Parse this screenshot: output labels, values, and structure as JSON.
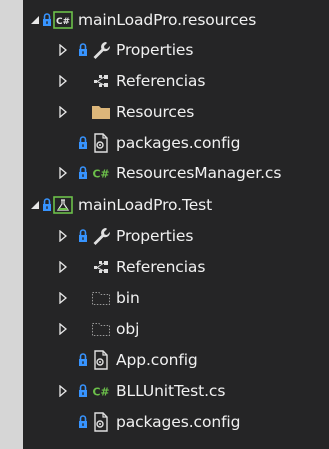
{
  "tree": {
    "items": [
      {
        "label": "mainLoadPro.resources",
        "icon": "csharp-project-icon",
        "expander": "expanded",
        "lock": true
      },
      {
        "label": "Properties",
        "icon": "wrench-icon",
        "expander": "collapsed",
        "lock": true
      },
      {
        "label": "Referencias",
        "icon": "references-icon",
        "expander": "collapsed",
        "lock": false
      },
      {
        "label": "Resources",
        "icon": "folder-icon",
        "expander": "collapsed",
        "lock": false
      },
      {
        "label": "packages.config",
        "icon": "config-file-icon",
        "expander": "none",
        "lock": true
      },
      {
        "label": "ResourcesManager.cs",
        "icon": "csharp-file-icon",
        "expander": "collapsed",
        "lock": true
      },
      {
        "label": "mainLoadPro.Test",
        "icon": "test-project-icon",
        "expander": "expanded",
        "lock": true
      },
      {
        "label": "Properties",
        "icon": "wrench-icon",
        "expander": "collapsed",
        "lock": true
      },
      {
        "label": "Referencias",
        "icon": "references-icon",
        "expander": "collapsed",
        "lock": false
      },
      {
        "label": "bin",
        "icon": "hidden-folder-icon",
        "expander": "collapsed",
        "lock": false
      },
      {
        "label": "obj",
        "icon": "hidden-folder-icon",
        "expander": "collapsed",
        "lock": false
      },
      {
        "label": "App.config",
        "icon": "config-file-icon",
        "expander": "none",
        "lock": true
      },
      {
        "label": "BLLUnitTest.cs",
        "icon": "csharp-file-icon",
        "expander": "collapsed",
        "lock": true
      },
      {
        "label": "packages.config",
        "icon": "config-file-icon",
        "expander": "none",
        "lock": true
      }
    ]
  },
  "colors": {
    "background": "#252526",
    "text": "#f1f1f1",
    "lock": "#3794ff",
    "csharp_green": "#6cc04a",
    "folder": "#dcb67a",
    "frame": "#d6d6d6"
  }
}
